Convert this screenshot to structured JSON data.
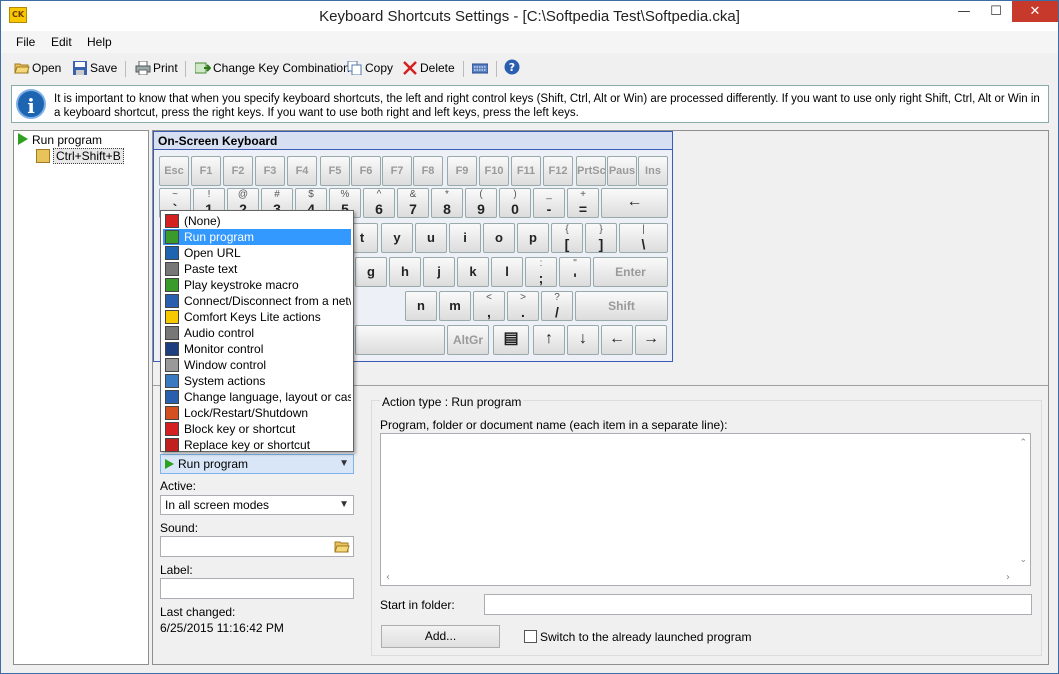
{
  "window": {
    "title": "Keyboard Shortcuts Settings - [C:\\Softpedia Test\\Softpedia.cka]",
    "app_icon": "CK",
    "controls": {
      "minimize": "—",
      "maximize": "☐",
      "close": "✕"
    }
  },
  "menu": {
    "file": "File",
    "edit": "Edit",
    "help": "Help"
  },
  "toolbar": {
    "open": "Open",
    "save": "Save",
    "print": "Print",
    "change_key": "Change Key Combination",
    "copy": "Copy",
    "delete": "Delete"
  },
  "info": {
    "text": "It is important to know that when you specify keyboard shortcuts, the left and right control keys (Shift, Ctrl, Alt or Win) are processed differently. If you want to use only right Shift, Ctrl, Alt or Win in a keyboard shortcut, press the right keys. If you want to use both right and left keys, press the left keys."
  },
  "tree": {
    "root": "Run program",
    "child": "Ctrl+Shift+B"
  },
  "keyboard": {
    "title": "On-Screen Keyboard",
    "row_fn": [
      "Esc",
      "F1",
      "F2",
      "F3",
      "F4",
      "F5",
      "F6",
      "F7",
      "F8",
      "F9",
      "F10",
      "F11",
      "F12",
      "PrtSc",
      "Paus",
      "Ins"
    ],
    "row_num": [
      {
        "t": "~",
        "b": "`"
      },
      {
        "t": "!",
        "b": "1"
      },
      {
        "t": "@",
        "b": "2"
      },
      {
        "t": "#",
        "b": "3"
      },
      {
        "t": "$",
        "b": "4"
      },
      {
        "t": "%",
        "b": "5"
      },
      {
        "t": "^",
        "b": "6"
      },
      {
        "t": "&",
        "b": "7"
      },
      {
        "t": "*",
        "b": "8"
      },
      {
        "t": "(",
        "b": "9"
      },
      {
        "t": ")",
        "b": "0"
      },
      {
        "t": "_",
        "b": "-"
      },
      {
        "t": "+",
        "b": "="
      }
    ],
    "backspace": "←",
    "row_q": [
      "t",
      "y",
      "u",
      "i",
      "o",
      "p"
    ],
    "row_q_brackets": [
      {
        "t": "{",
        "b": "["
      },
      {
        "t": "}",
        "b": "]"
      },
      {
        "t": "|",
        "b": "\\"
      }
    ],
    "row_a": [
      "g",
      "h",
      "j",
      "k",
      "l"
    ],
    "row_a_punct": [
      {
        "t": ":",
        "b": ";"
      },
      {
        "t": "\"",
        "b": "'"
      }
    ],
    "enter": "Enter",
    "row_z": [
      "n",
      "m"
    ],
    "row_z_punct": [
      {
        "t": "<",
        "b": ","
      },
      {
        "t": ">",
        "b": "."
      },
      {
        "t": "?",
        "b": "/"
      }
    ],
    "shift": "Shift",
    "altgr": "AltGr",
    "arrows": [
      "↑",
      "↓",
      "←",
      "→"
    ]
  },
  "action_menu": {
    "items": [
      "(None)",
      "Run program",
      "Open URL",
      "Paste text",
      "Play keystroke macro",
      "Connect/Disconnect from a network",
      "Comfort Keys Lite actions",
      "Audio control",
      "Monitor control",
      "Window control",
      "System actions",
      "Change language, layout or case",
      "Lock/Restart/Shutdown",
      "Block key or shortcut",
      "Replace key or shortcut"
    ],
    "selected_index": 1
  },
  "settings": {
    "action_value": "Run program",
    "active_label": "Active:",
    "active_value": "In all screen modes",
    "sound_label": "Sound:",
    "label_label": "Label:",
    "last_changed_label": "Last changed:",
    "last_changed_value": "6/25/2015 11:16:42 PM"
  },
  "action_panel": {
    "type_label": "Action type : Run program",
    "program_label": "Program, folder or document name (each item in a separate line):",
    "start_folder_label": "Start in folder:",
    "add_button": "Add...",
    "switch_checkbox": "Switch to the already launched program"
  },
  "colors": {
    "accent": "#3399ff",
    "keyboard_border": "#3b5bb5",
    "close_button": "#c7392b"
  }
}
